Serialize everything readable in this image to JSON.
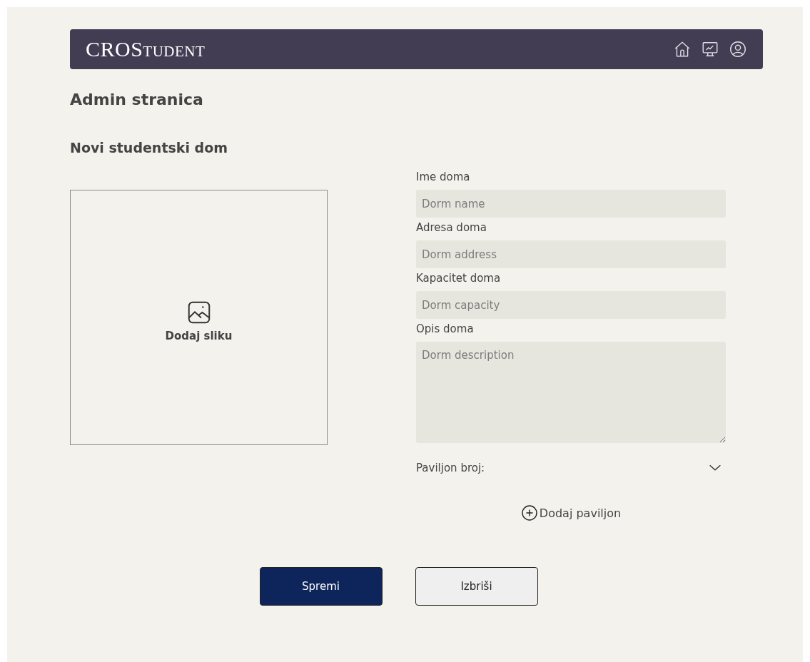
{
  "header": {
    "logo": "CROStudent",
    "nav_icons": [
      {
        "kind": "home"
      },
      {
        "kind": "chart"
      },
      {
        "kind": "user"
      }
    ]
  },
  "page_title": "Admin stranica",
  "section_title": "Novi studentski dom",
  "image_upload": {
    "label": "Dodaj sliku"
  },
  "fields": [
    {
      "kind": "input",
      "label": "Ime doma",
      "placeholder": "Dorm name"
    },
    {
      "kind": "input",
      "label": "Adresa doma",
      "placeholder": "Dorm address"
    },
    {
      "kind": "input",
      "label": "Kapacitet doma",
      "placeholder": "Dorm capacity"
    },
    {
      "kind": "textarea",
      "label": "Opis doma",
      "placeholder": "Dorm description"
    }
  ],
  "dropdown": {
    "label": "Paviljon broj:"
  },
  "add_button": {
    "label": "Dodaj paviljon"
  },
  "buttons": [
    {
      "kind": "primary",
      "label": "Spremi"
    },
    {
      "kind": "secondary",
      "label": "Izbriši"
    }
  ]
}
